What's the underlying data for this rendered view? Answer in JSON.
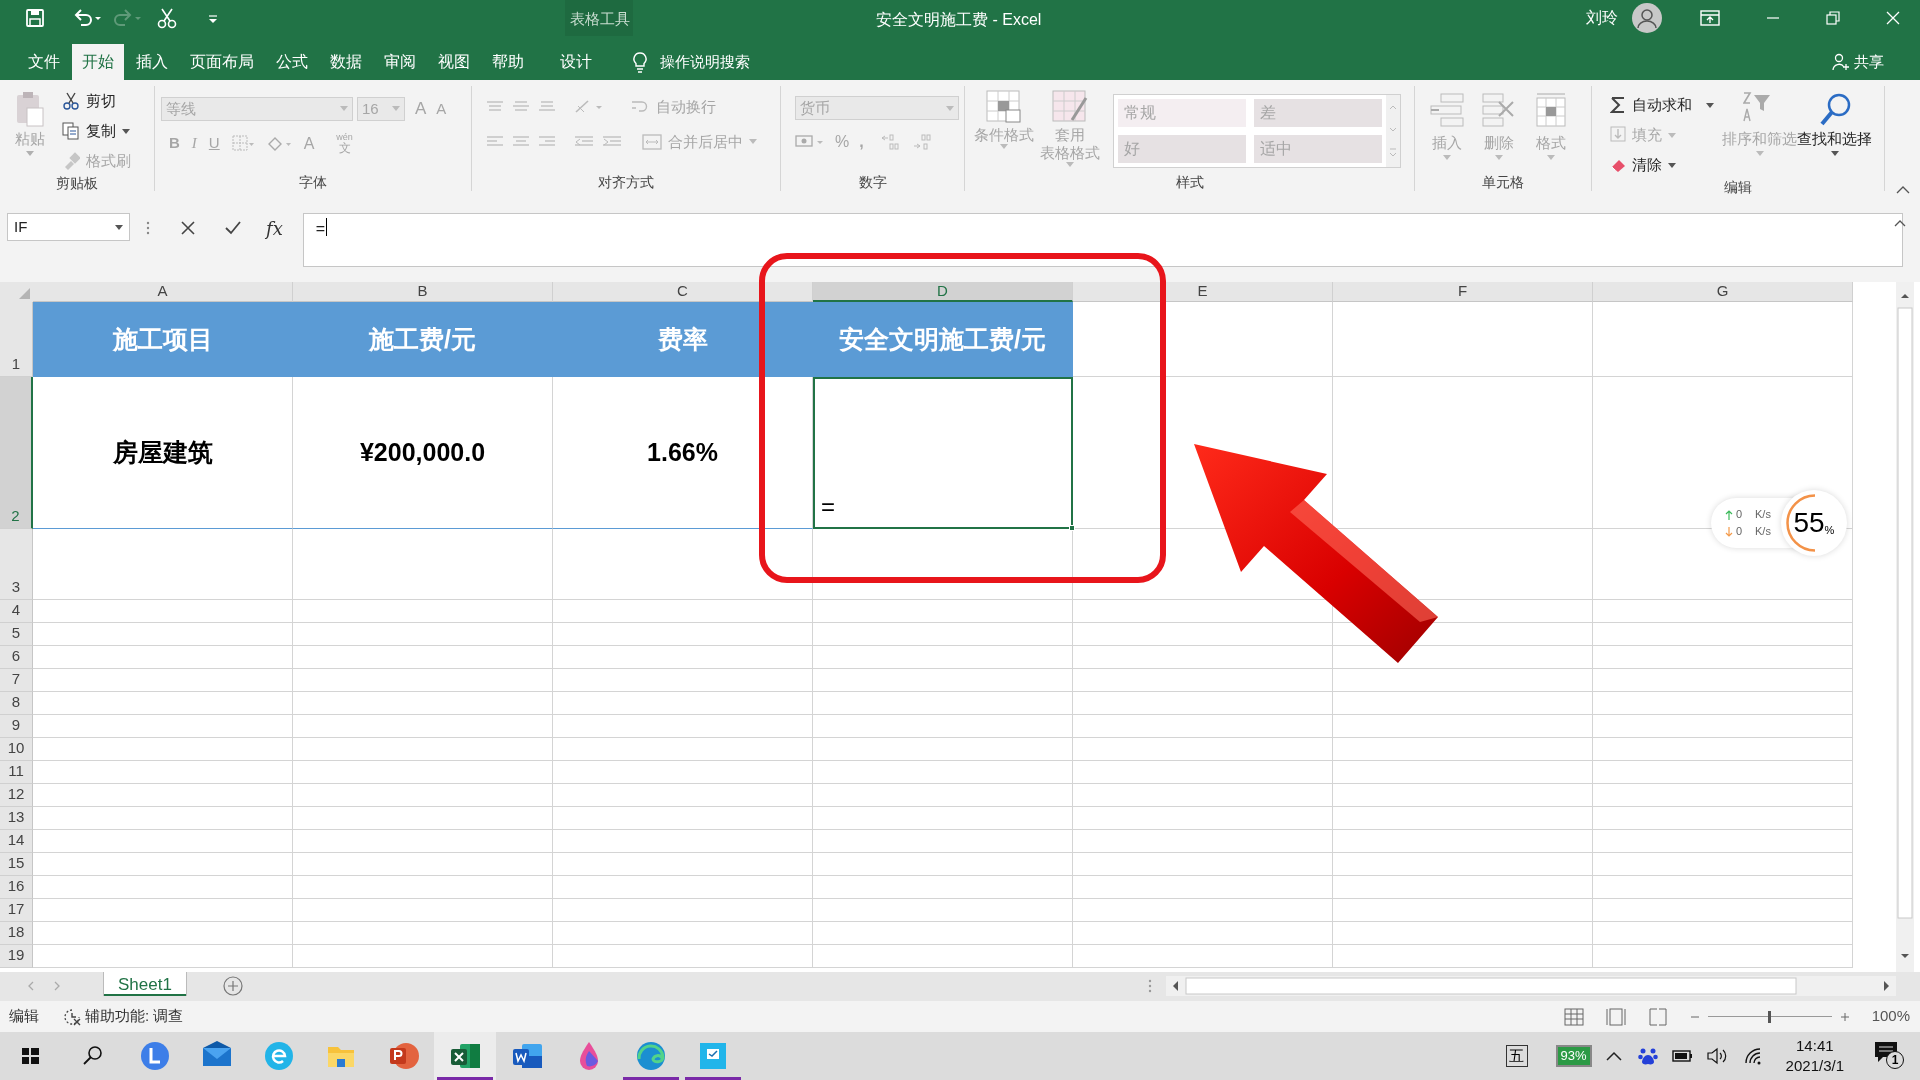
{
  "window": {
    "title": "安全文明施工费  -  Excel",
    "context_label": "表格工具",
    "user": "刘玲"
  },
  "tabs": [
    {
      "label": "文件",
      "selected": false,
      "kind": "normal"
    },
    {
      "label": "开始",
      "selected": true,
      "kind": "normal"
    },
    {
      "label": "插入",
      "selected": false,
      "kind": "normal"
    },
    {
      "label": "页面布局",
      "selected": false,
      "kind": "normal"
    },
    {
      "label": "公式",
      "selected": false,
      "kind": "normal"
    },
    {
      "label": "数据",
      "selected": false,
      "kind": "normal"
    },
    {
      "label": "审阅",
      "selected": false,
      "kind": "normal"
    },
    {
      "label": "视图",
      "selected": false,
      "kind": "normal"
    },
    {
      "label": "帮助",
      "selected": false,
      "kind": "normal"
    },
    {
      "label": "设计",
      "selected": false,
      "kind": "context"
    }
  ],
  "tell_me": "操作说明搜索",
  "share": "共享",
  "ribbon": [
    {
      "kind": "clipboard",
      "label": "剪贴板",
      "items": [
        {
          "label": "粘贴",
          "disabled": true
        },
        {
          "label": "剪切",
          "disabled": false
        },
        {
          "label": "复制",
          "disabled": false
        },
        {
          "label": "格式刷",
          "disabled": true
        }
      ]
    },
    {
      "kind": "font",
      "label": "字体",
      "font_name": "等线",
      "font_size": "16",
      "grow": "A",
      "shrink": "A",
      "format_buttons": [
        "B",
        "I",
        "U"
      ],
      "font_color": "A",
      "phonetic_top": "wén",
      "phonetic_bottom": "文"
    },
    {
      "kind": "alignment",
      "label": "对齐方式",
      "items": [
        "自动换行",
        "合并后居中"
      ]
    },
    {
      "kind": "number",
      "label": "数字",
      "format": "货币",
      "percent": "%",
      "comma": ","
    },
    {
      "kind": "styles",
      "label": "样式",
      "buttons": [
        [
          "条件格式"
        ],
        [
          "套用",
          "表格格式"
        ]
      ],
      "cell_styles": [
        "常规",
        "差",
        "好",
        "适中"
      ]
    },
    {
      "kind": "cells",
      "label": "单元格",
      "items": [
        "插入",
        "删除",
        "格式"
      ]
    },
    {
      "kind": "editing",
      "label": "编辑",
      "items": [
        {
          "label": "自动求和",
          "disabled": false
        },
        {
          "label": "填充",
          "disabled": true
        },
        {
          "label": "清除",
          "disabled": false
        },
        {
          "label": "排序和筛选",
          "disabled": true
        },
        {
          "label": "查找和选择",
          "disabled": false
        }
      ]
    }
  ],
  "formula_bar": {
    "name_box": "IF",
    "fx": "fx",
    "value": "="
  },
  "grid": {
    "columns": [
      {
        "label": "A",
        "selected": false
      },
      {
        "label": "B",
        "selected": false
      },
      {
        "label": "C",
        "selected": false
      },
      {
        "label": "D",
        "selected": true
      },
      {
        "label": "E",
        "selected": false
      },
      {
        "label": "F",
        "selected": false
      },
      {
        "label": "G",
        "selected": false
      }
    ],
    "rows": [
      {
        "label": "1",
        "selected": false,
        "cells": [
          {
            "text": "施工项目",
            "kind": "header"
          },
          {
            "text": "施工费/元",
            "kind": "header"
          },
          {
            "text": "费率",
            "kind": "header"
          },
          {
            "text": "安全文明施工费/元",
            "kind": "header"
          }
        ]
      },
      {
        "label": "2",
        "selected": true,
        "cells": [
          {
            "text": "房屋建筑",
            "kind": "value"
          },
          {
            "text": "¥200,000.0",
            "kind": "value"
          },
          {
            "text": "1.66%",
            "kind": "value"
          },
          {
            "text": "=",
            "kind": "editing"
          }
        ]
      },
      {
        "label": "3",
        "selected": false
      },
      {
        "label": "4",
        "selected": false
      },
      {
        "label": "5",
        "selected": false
      },
      {
        "label": "6",
        "selected": false
      },
      {
        "label": "7",
        "selected": false
      },
      {
        "label": "8",
        "selected": false
      },
      {
        "label": "9",
        "selected": false
      },
      {
        "label": "10",
        "selected": false
      },
      {
        "label": "11",
        "selected": false
      },
      {
        "label": "12",
        "selected": false
      },
      {
        "label": "13",
        "selected": false
      },
      {
        "label": "14",
        "selected": false
      },
      {
        "label": "15",
        "selected": false
      },
      {
        "label": "16",
        "selected": false
      },
      {
        "label": "17",
        "selected": false
      },
      {
        "label": "18",
        "selected": false
      },
      {
        "label": "19",
        "selected": false
      }
    ]
  },
  "sheets": [
    {
      "label": "Sheet1",
      "selected": true
    }
  ],
  "status_bar": {
    "mode": "编辑",
    "accessibility": "辅助功能: 调查",
    "zoom": "100%",
    "zoom_slider": {
      "level": 0.5
    }
  },
  "network_widget": {
    "upload": "0",
    "upload_unit": "K/s",
    "download": "0",
    "download_unit": "K/s",
    "usage": "55",
    "usage_unit": "%"
  },
  "taskbar": {
    "apps": [
      {
        "kind": "start",
        "running": false,
        "selected": false
      },
      {
        "kind": "search",
        "running": false,
        "selected": false
      },
      {
        "kind": "l-badge",
        "running": false,
        "selected": false
      },
      {
        "kind": "mail",
        "running": false,
        "selected": false
      },
      {
        "kind": "e-badge",
        "running": false,
        "selected": false
      },
      {
        "kind": "folder",
        "running": false,
        "selected": false
      },
      {
        "kind": "p-app",
        "running": false,
        "selected": false
      },
      {
        "kind": "x-app",
        "running": true,
        "selected": true
      },
      {
        "kind": "w-app",
        "running": false,
        "selected": false
      },
      {
        "kind": "drop",
        "running": false,
        "selected": false
      },
      {
        "kind": "wave",
        "running": true,
        "selected": false
      },
      {
        "kind": "board",
        "running": true,
        "selected": false
      }
    ],
    "ime": "五",
    "battery": "93%",
    "time": "14:41",
    "date": "2021/3/1",
    "notifications": "1"
  }
}
